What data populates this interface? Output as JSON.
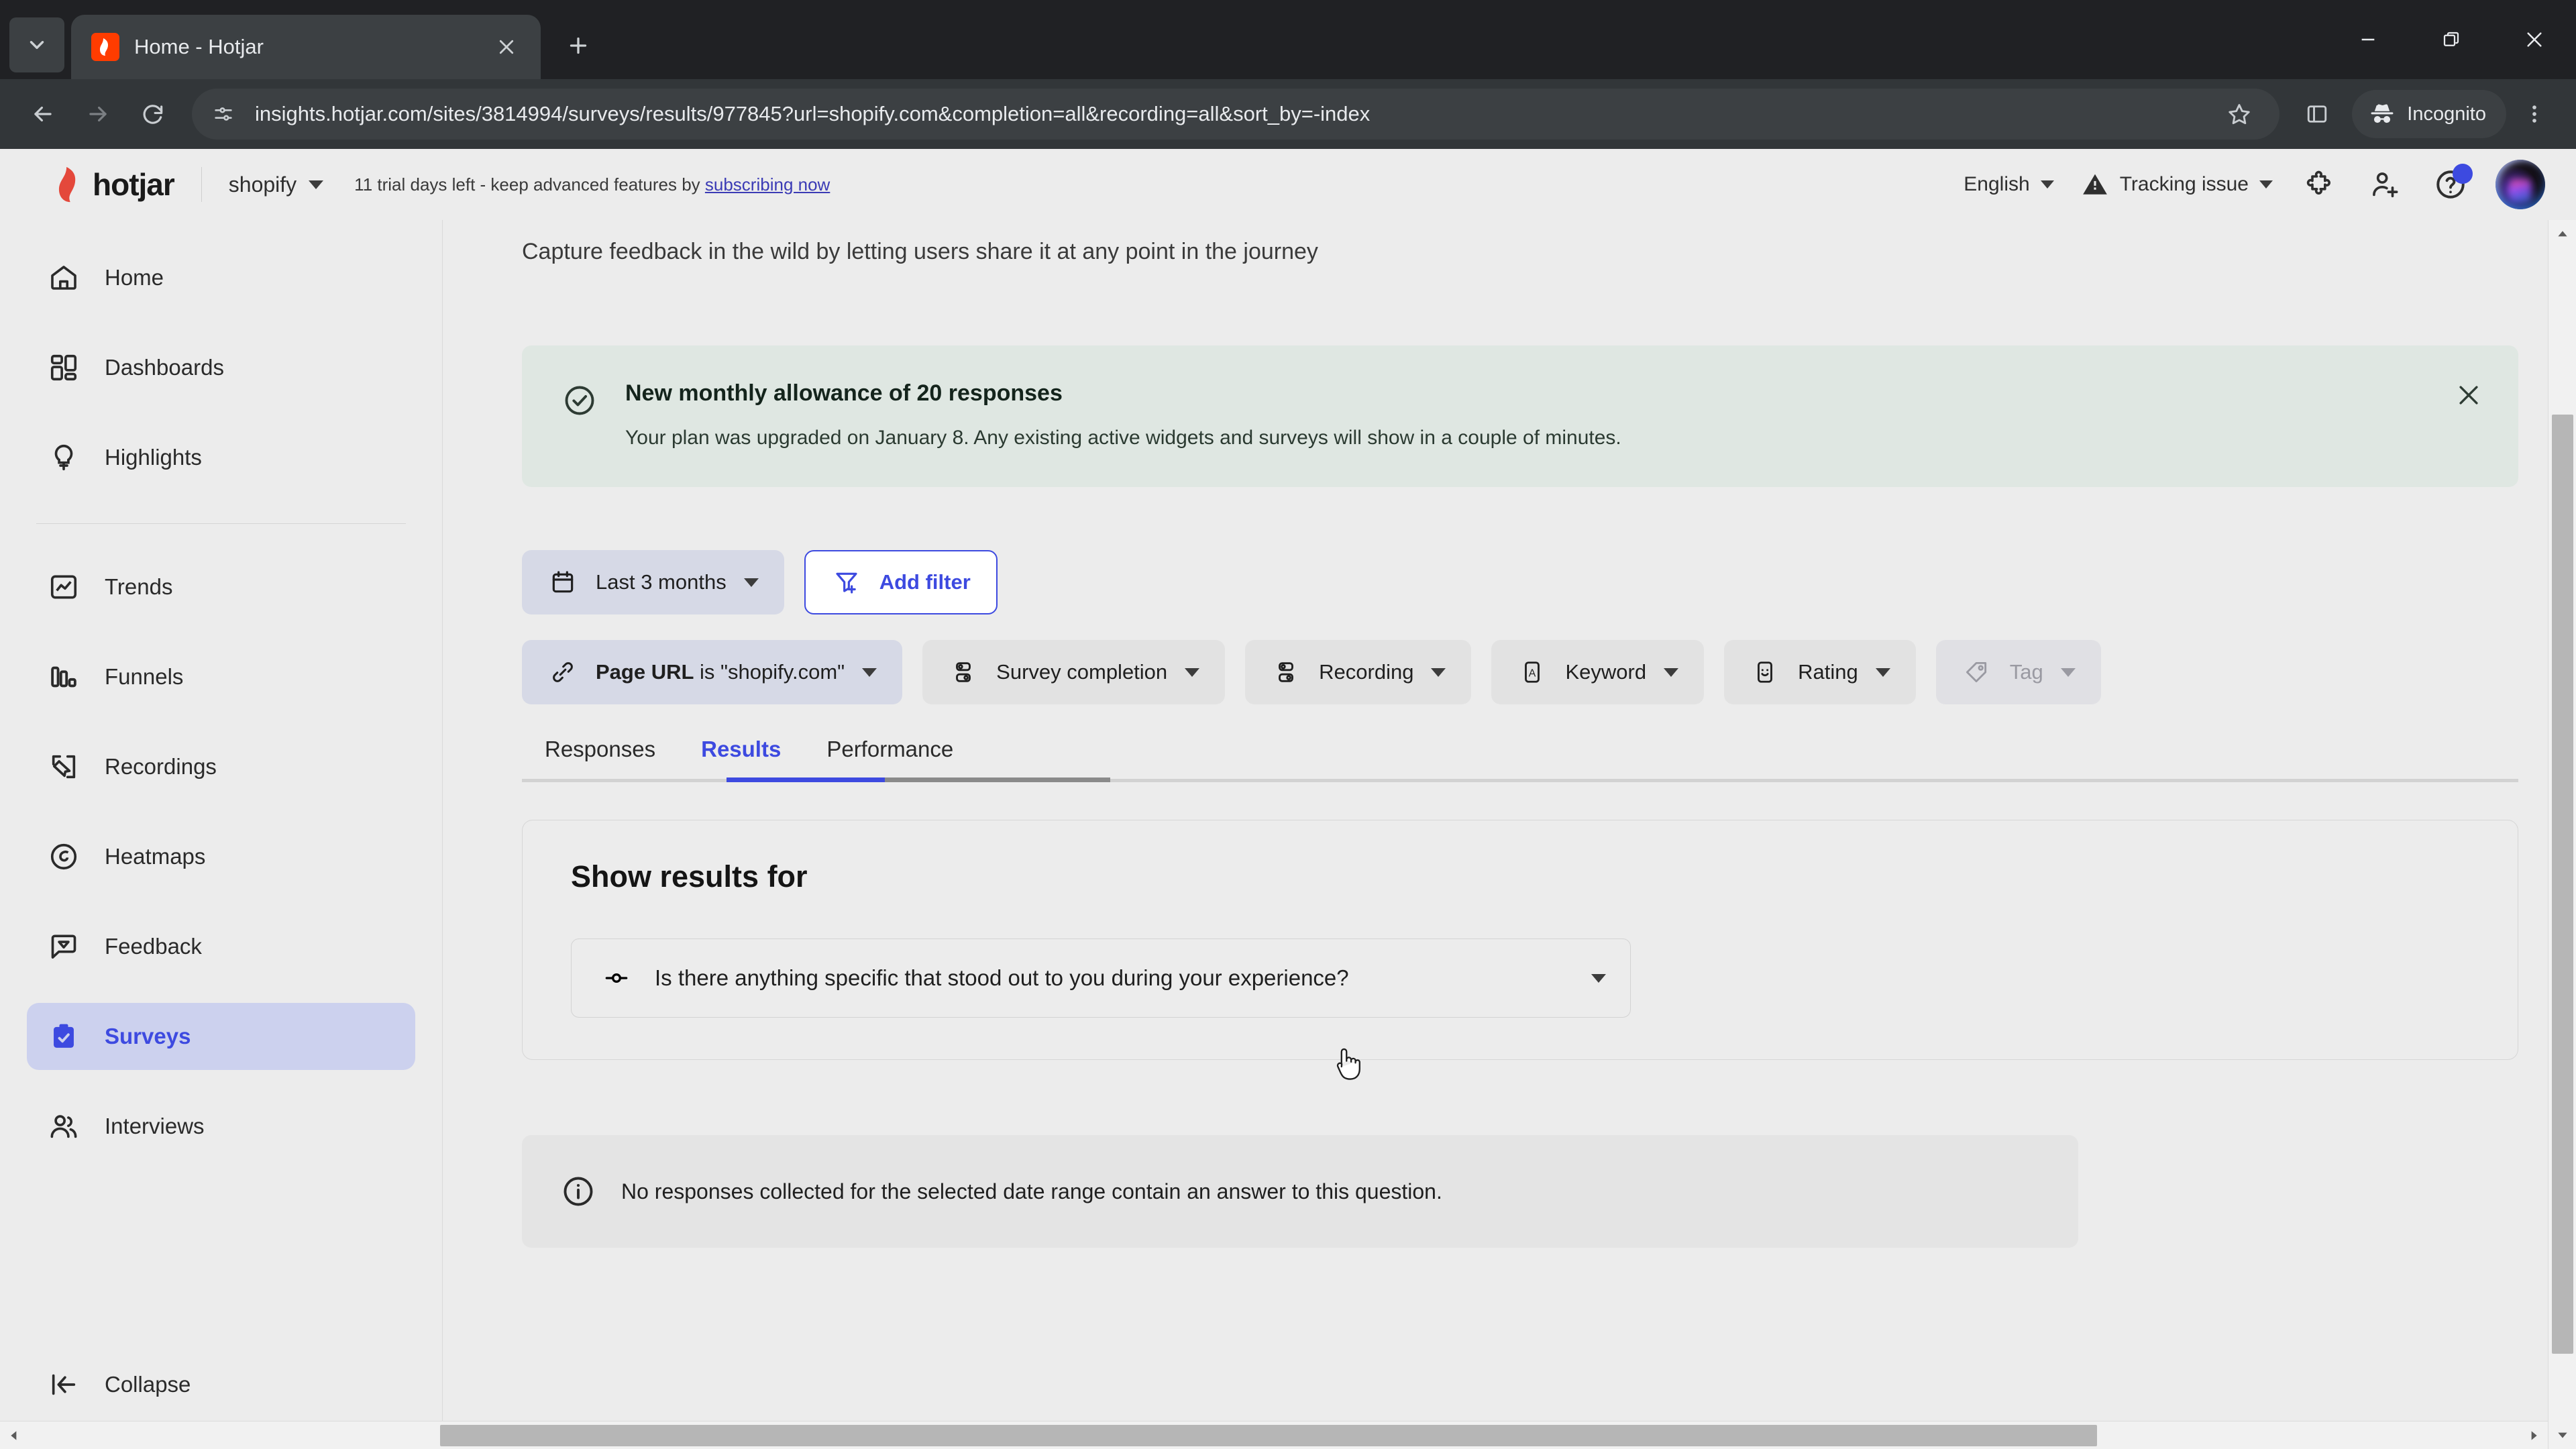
{
  "browser": {
    "tab": {
      "title": "Home - Hotjar",
      "favicon": "hotjar-favicon"
    },
    "new_tab_label": "+",
    "tab_search_icon": "chevron-down-icon",
    "close_tab_icon": "close-icon",
    "window_controls": {
      "minimize": "minimize-icon",
      "maximize": "restore-icon",
      "close": "close-icon"
    },
    "nav": {
      "back": "back-arrow-icon",
      "forward": "forward-arrow-icon",
      "reload": "reload-icon"
    },
    "omnibox": {
      "site_info_icon": "page-settings-icon",
      "url": "insights.hotjar.com/sites/3814994/surveys/results/977845?url=shopify.com&completion=all&recording=all&sort_by=-index",
      "bookmark_icon": "star-icon",
      "sidepanel_icon": "side-panel-icon",
      "menu_icon": "three-dot-menu-icon"
    },
    "incognito": {
      "label": "Incognito",
      "icon": "incognito-icon"
    }
  },
  "header": {
    "logo_text": "hotjar",
    "site_name": "shopify",
    "trial_text": "11 trial days left - keep advanced features by",
    "trial_link": "subscribing now",
    "language": "English",
    "tracking_status": "Tracking issue",
    "warning_icon": "warning-triangle-icon",
    "extensions_icon": "puzzle-piece-icon",
    "invite_icon": "add-user-icon",
    "help_icon": "question-mark-icon",
    "avatar": "user-avatar"
  },
  "sidebar": {
    "items": [
      {
        "label": "Home",
        "icon": "home-icon",
        "active": false
      },
      {
        "label": "Dashboards",
        "icon": "dashboards-grid-icon",
        "active": false
      },
      {
        "label": "Highlights",
        "icon": "lightbulb-icon",
        "active": false
      },
      {
        "label": "Trends",
        "icon": "trends-chart-icon",
        "active": false
      },
      {
        "label": "Funnels",
        "icon": "funnels-bars-icon",
        "active": false
      },
      {
        "label": "Recordings",
        "icon": "recordings-cursor-icon",
        "active": false
      },
      {
        "label": "Heatmaps",
        "icon": "heatmap-icon",
        "active": false
      },
      {
        "label": "Feedback",
        "icon": "feedback-bubble-icon",
        "active": false
      },
      {
        "label": "Surveys",
        "icon": "surveys-clipboard-icon",
        "active": true
      },
      {
        "label": "Interviews",
        "icon": "interviews-people-icon",
        "active": false
      }
    ],
    "collapse": {
      "label": "Collapse",
      "icon": "collapse-left-icon"
    }
  },
  "main": {
    "subtitle": "Capture feedback in the wild by letting users share it at any point in the journey",
    "banner": {
      "icon": "check-circle-icon",
      "title": "New monthly allowance of 20 responses",
      "text": "Your plan was upgraded on January 8. Any existing active widgets and surveys will show in a couple of minutes.",
      "close_icon": "close-icon",
      "background": "#dfe7e2"
    },
    "filters": {
      "date_range": {
        "label": "Last 3 months",
        "icon": "calendar-icon"
      },
      "add_filter": {
        "label": "Add filter",
        "icon": "filter-plus-icon"
      },
      "chips": [
        {
          "label_strong": "Page URL",
          "label": " is \"shopify.com\"",
          "icon": "link-icon",
          "state": "active"
        },
        {
          "label_strong": "",
          "label": "Survey completion",
          "icon": "toggle-list-icon",
          "state": "plain"
        },
        {
          "label_strong": "",
          "label": "Recording",
          "icon": "toggle-list-icon",
          "state": "plain"
        },
        {
          "label_strong": "",
          "label": "Keyword",
          "icon": "keyword-a-icon",
          "state": "plain"
        },
        {
          "label_strong": "",
          "label": "Rating",
          "icon": "smiley-rating-icon",
          "state": "plain"
        },
        {
          "label_strong": "",
          "label": "Tag",
          "icon": "tag-icon",
          "state": "disabled"
        }
      ]
    },
    "tabs": [
      {
        "label": "Responses",
        "active": false
      },
      {
        "label": "Results",
        "active": true
      },
      {
        "label": "Performance",
        "active": false
      }
    ],
    "results_card": {
      "title": "Show results for",
      "question_select": {
        "icon": "open-question-icon",
        "value": "Is there anything specific that stood out to you during your experience?",
        "caret": "chevron-down-icon"
      }
    },
    "empty_state": {
      "icon": "info-circle-icon",
      "text": "No responses collected for the selected date range contain an answer to this question."
    }
  },
  "colors": {
    "accent": "#3d4ae0",
    "page_bg": "#ececec",
    "banner_bg": "#dfe7e2",
    "active_nav_bg": "#ccd1ee",
    "chrome_dark": "#202124",
    "toolbar_dark": "#323639"
  }
}
